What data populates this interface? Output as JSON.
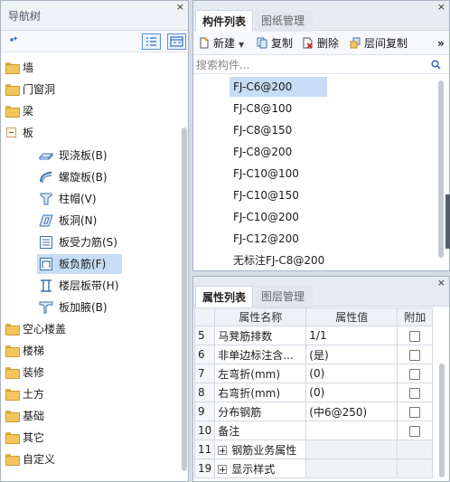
{
  "nav_panel": {
    "title": "导航树",
    "close": "×",
    "tree": [
      {
        "label": "墙",
        "expanded": false
      },
      {
        "label": "门窗洞",
        "expanded": false
      },
      {
        "label": "梁",
        "expanded": false
      },
      {
        "label": "板",
        "expanded": true,
        "children": [
          {
            "label": "现浇板(B)",
            "icon": "cast-slab-icon"
          },
          {
            "label": "螺旋板(B)",
            "icon": "spiral-slab-icon"
          },
          {
            "label": "柱帽(V)",
            "icon": "column-cap-icon"
          },
          {
            "label": "板洞(N)",
            "icon": "slab-hole-icon"
          },
          {
            "label": "板受力筋(S)",
            "icon": "slab-rebar-icon"
          },
          {
            "label": "板负筋(F)",
            "icon": "slab-negative-rebar-icon",
            "selected": true
          },
          {
            "label": "楼层板带(H)",
            "icon": "floor-strip-icon"
          },
          {
            "label": "板加腋(B)",
            "icon": "slab-haunch-icon"
          }
        ]
      },
      {
        "label": "空心楼盖",
        "expanded": false
      },
      {
        "label": "楼梯",
        "expanded": false
      },
      {
        "label": "装修",
        "expanded": false
      },
      {
        "label": "土方",
        "expanded": false
      },
      {
        "label": "基础",
        "expanded": false
      },
      {
        "label": "其它",
        "expanded": false
      },
      {
        "label": "自定义",
        "expanded": false
      }
    ]
  },
  "component_panel": {
    "close": "×",
    "tabs": [
      {
        "label": "构件列表",
        "active": true
      },
      {
        "label": "图纸管理",
        "active": false
      }
    ],
    "toolbar": {
      "new": "新建",
      "copy": "复制",
      "delete": "删除",
      "floor_copy": "层间复制",
      "more": "»"
    },
    "search_placeholder": "搜索构件...",
    "items": [
      "FJ-C6@200",
      "FJ-C8@100",
      "FJ-C8@150",
      "FJ-C8@200",
      "FJ-C10@100",
      "FJ-C10@150",
      "FJ-C10@200",
      "FJ-C12@200",
      "无标注FJ-C8@200"
    ],
    "selected_index": 0
  },
  "property_panel": {
    "close": "×",
    "tabs": [
      {
        "label": "属性列表",
        "active": true
      },
      {
        "label": "图层管理",
        "active": false
      }
    ],
    "headers": {
      "name": "属性名称",
      "value": "属性值",
      "extra": "附加"
    },
    "rows": [
      {
        "num": "5",
        "name": "马凳筋排数",
        "value": "1/1",
        "checkbox": true
      },
      {
        "num": "6",
        "name": "非单边标注含...",
        "value": "(是)",
        "checkbox": true
      },
      {
        "num": "7",
        "name": "左弯折(mm)",
        "value": "(0)",
        "checkbox": true
      },
      {
        "num": "8",
        "name": "右弯折(mm)",
        "value": "(0)",
        "checkbox": true
      },
      {
        "num": "9",
        "name": "分布钢筋",
        "value": "(中6@250)",
        "checkbox": true
      },
      {
        "num": "10",
        "name": "备注",
        "value": "",
        "checkbox": true
      },
      {
        "num": "11",
        "name": "钢筋业务属性",
        "value": "",
        "group": true
      },
      {
        "num": "19",
        "name": "显示样式",
        "value": "",
        "group": true
      }
    ]
  },
  "colors": {
    "selection": "#c6ddf5",
    "panel_border": "#a9b3c2",
    "title_bar": "#eef1f6"
  }
}
